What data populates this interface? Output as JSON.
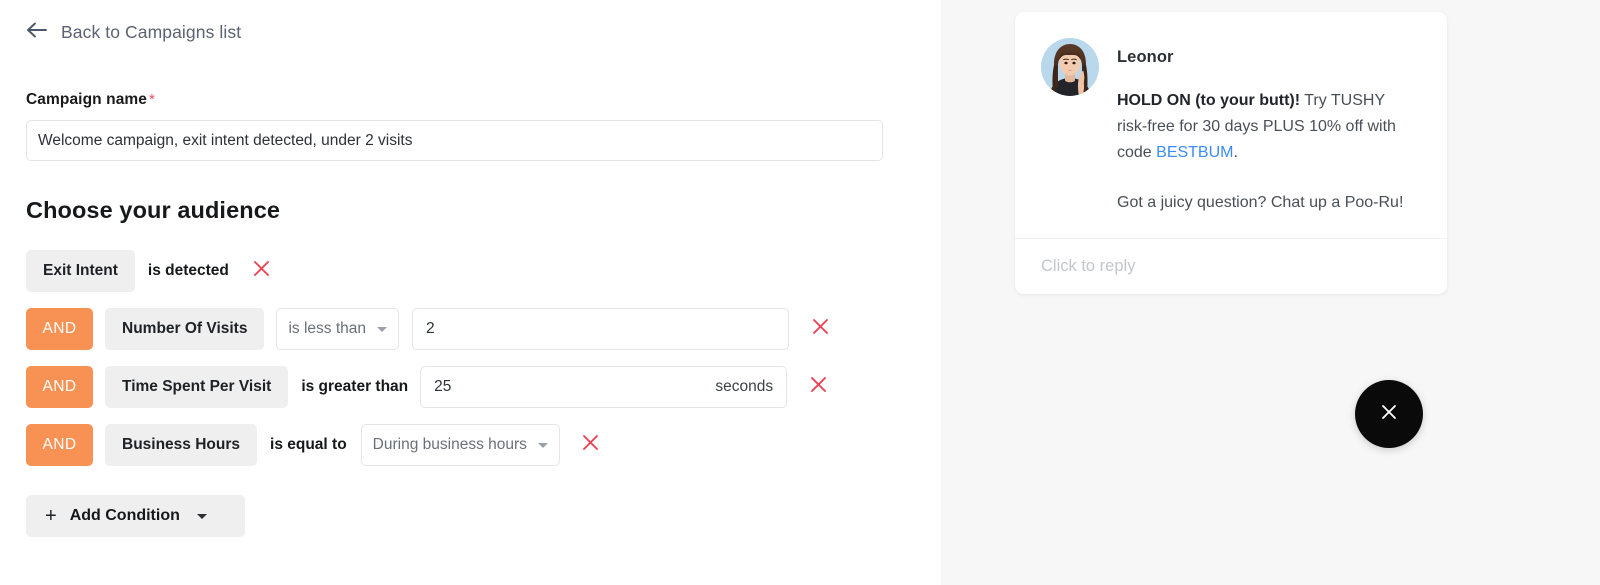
{
  "editor": {
    "back_link": {
      "label": "Back to Campaigns list",
      "icon": "arrow-left-icon"
    },
    "campaign_name": {
      "label": "Campaign name",
      "required_marker": "*",
      "value": "Welcome campaign, exit intent detected, under 2 visits",
      "placeholder": "Campaign name"
    },
    "audience": {
      "title": "Choose your audience",
      "conditions": [
        {
          "connector": null,
          "attribute": "Exit Intent",
          "operator_text": "is detected",
          "value": null,
          "unit": null,
          "remove_label": "Remove condition"
        },
        {
          "connector": "AND",
          "attribute": "Number Of Visits",
          "operator_select": "is less than",
          "value": "2",
          "unit": null,
          "remove_label": "Remove condition"
        },
        {
          "connector": "AND",
          "attribute": "Time Spent Per Visit",
          "operator_text": "is greater than",
          "value": "25",
          "unit": "seconds",
          "remove_label": "Remove condition"
        },
        {
          "connector": "AND",
          "attribute": "Business Hours",
          "operator_text": "is equal to",
          "value_select": "During business hours",
          "unit": null,
          "remove_label": "Remove condition"
        }
      ],
      "add_condition": {
        "plus": "+",
        "label": "Add Condition"
      }
    }
  },
  "preview": {
    "chat": {
      "agent_name": "Leonor",
      "message_line_1_bold": "HOLD ON (to your butt)!",
      "message_line_1_rest": " Try TUSHY risk-free for 30 days PLUS 10% off with code ",
      "message_link": "BESTBUM",
      "message_line_1_end": ".",
      "message_line_2": "Got a juicy question? Chat up a Poo-Ru!",
      "reply_placeholder": "Click to reply"
    },
    "close_button": {
      "icon": "close-icon",
      "label": "Close chat"
    }
  },
  "colors": {
    "connector_orange": "#F79254",
    "remove_red": "#ef4152",
    "link_blue": "#3b8cf5",
    "chip_gray": "#efefef",
    "preview_bg": "#f7f7f8",
    "fab_black": "#0a0a0a",
    "required_red": "#ef4e5e"
  }
}
